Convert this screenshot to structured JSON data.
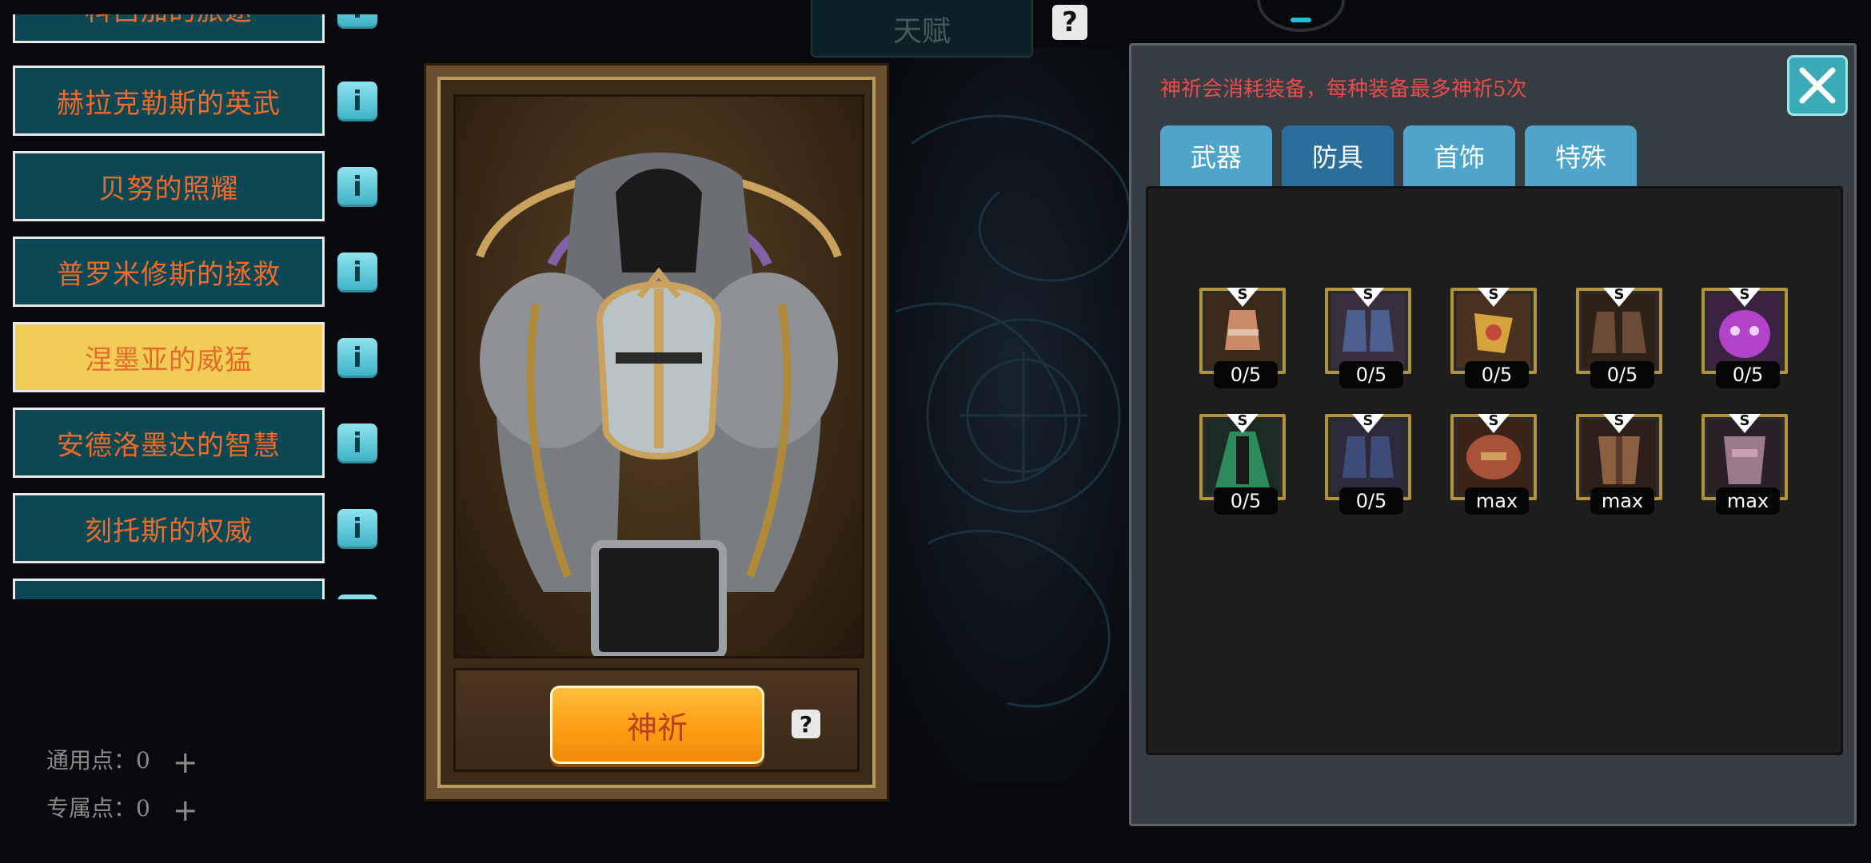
{
  "left_list": {
    "items": [
      {
        "label": "科吕加的旅途",
        "active": false
      },
      {
        "label": "赫拉克勒斯的英武",
        "active": false
      },
      {
        "label": "贝努的照耀",
        "active": false
      },
      {
        "label": "普罗米修斯的拯救",
        "active": false
      },
      {
        "label": "涅墨亚的威猛",
        "active": true
      },
      {
        "label": "安德洛墨达的智慧",
        "active": false
      },
      {
        "label": "刻托斯的权威",
        "active": false
      },
      {
        "label": "",
        "active": false
      }
    ],
    "info_label": "i"
  },
  "points": {
    "general_label": "通用点：",
    "general_value": "0",
    "exclusive_label": "专属点：",
    "exclusive_value": "0",
    "plus": "+"
  },
  "top": {
    "tab_label": "天赋",
    "help": "?"
  },
  "center": {
    "pray_label": "神祈",
    "help": "?"
  },
  "panel": {
    "warning": "神祈会消耗装备，每种装备最多神祈5次",
    "tabs": [
      {
        "label": "武器",
        "active": false
      },
      {
        "label": "防具",
        "active": true
      },
      {
        "label": "首饰",
        "active": false
      },
      {
        "label": "特殊",
        "active": false
      }
    ],
    "items": [
      {
        "badge": "S",
        "count": "0/5",
        "icon": "gauntlet-icon",
        "color": "#c98b6a"
      },
      {
        "badge": "S",
        "count": "0/5",
        "icon": "boots-icon",
        "color": "#4d5f8e"
      },
      {
        "badge": "S",
        "count": "0/5",
        "icon": "gauntlet-icon",
        "color": "#d6a23c"
      },
      {
        "badge": "S",
        "count": "0/5",
        "icon": "boots-icon",
        "color": "#6b4a36"
      },
      {
        "badge": "S",
        "count": "0/5",
        "icon": "mask-icon",
        "color": "#b043c8"
      },
      {
        "badge": "S",
        "count": "0/5",
        "icon": "cloak-icon",
        "color": "#2e8a5a"
      },
      {
        "badge": "S",
        "count": "0/5",
        "icon": "boots-icon",
        "color": "#3e4a78"
      },
      {
        "badge": "S",
        "count": "max",
        "icon": "shoulder-armor-icon",
        "color": "#a8523a"
      },
      {
        "badge": "S",
        "count": "max",
        "icon": "chest-armor-icon",
        "color": "#8a5f42"
      },
      {
        "badge": "S",
        "count": "max",
        "icon": "chest-armor-icon",
        "color": "#9a7a88"
      }
    ]
  },
  "colors": {
    "accent_orange": "#ff9d14",
    "list_bg": "#0c4754",
    "list_active": "#f2cd56",
    "tab_blue": "#4fa4c9",
    "tab_active": "#2a6f9c",
    "warning_red": "#e84c4c"
  }
}
